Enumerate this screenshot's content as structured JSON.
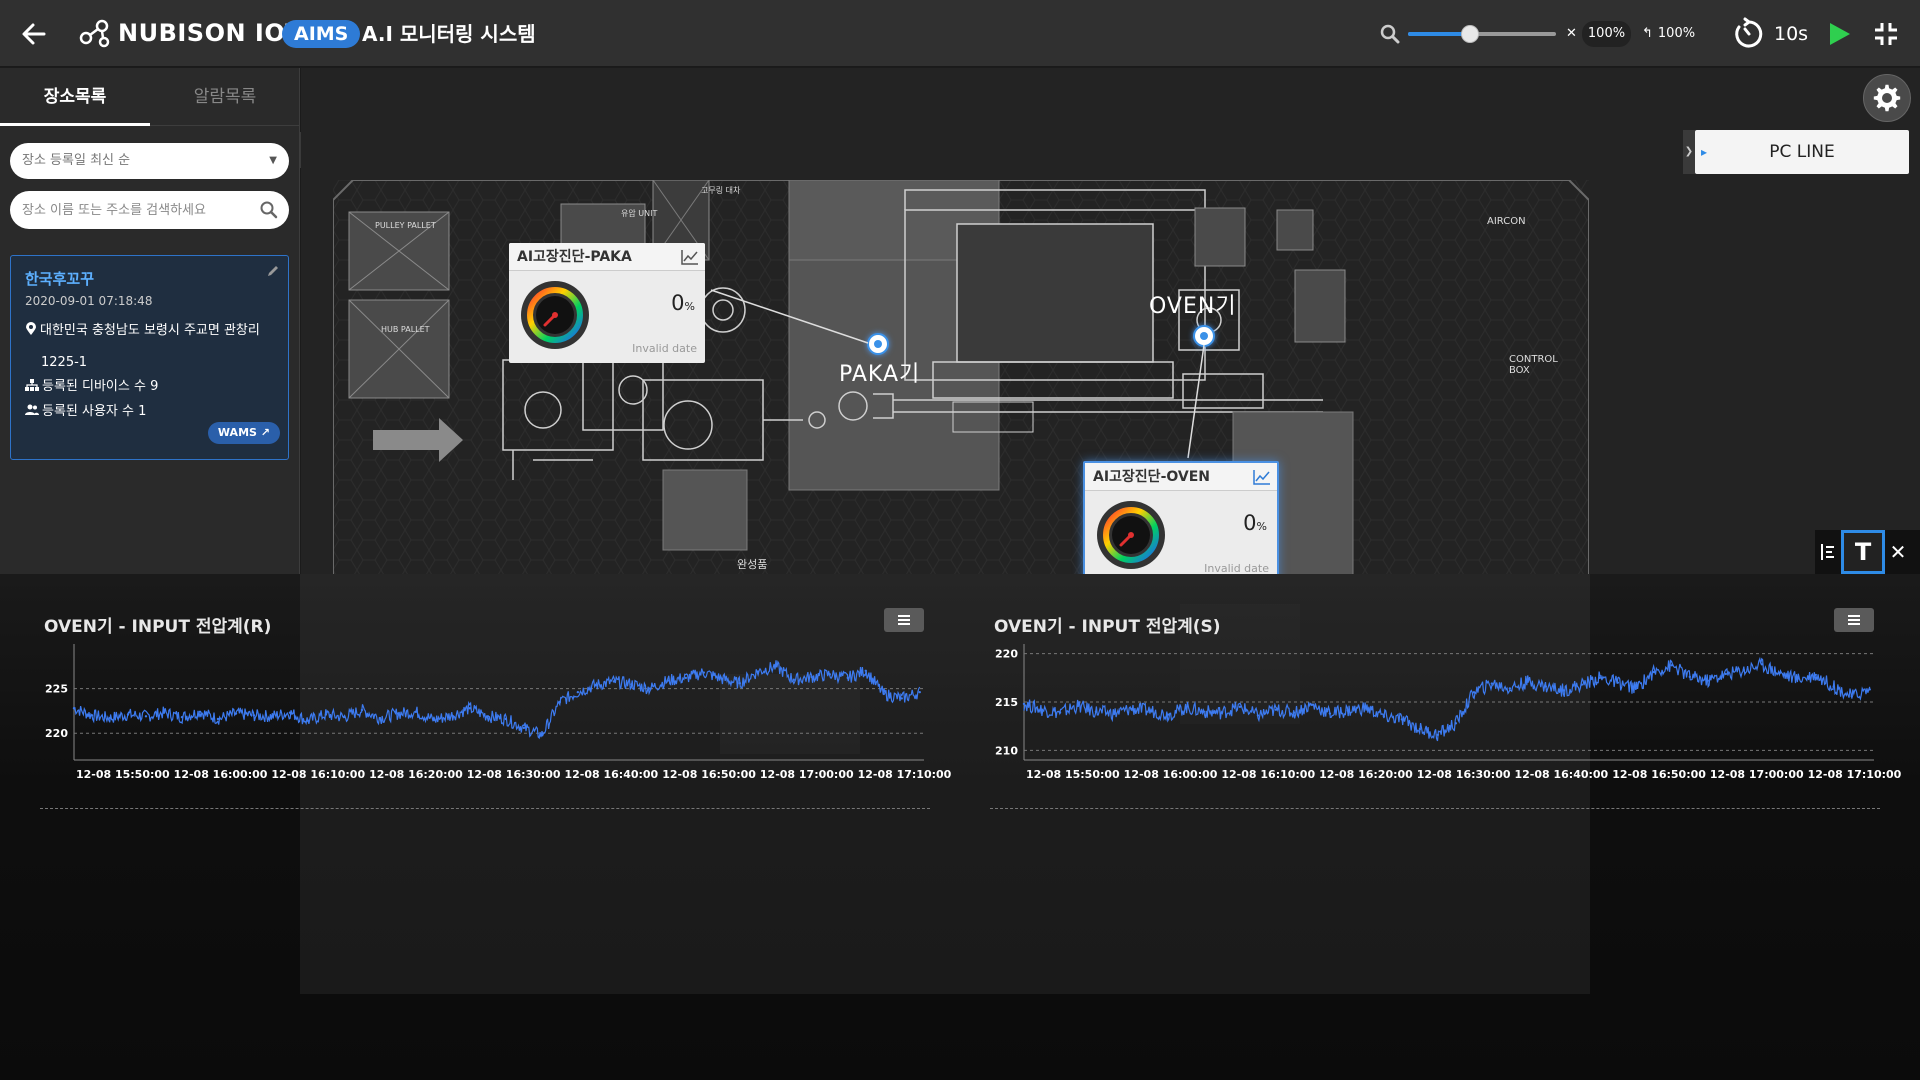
{
  "header": {
    "logo_text": "NUBISON IOT",
    "badge": "AIMS",
    "title": "A.I 모니터링 시스템",
    "zoom": {
      "level": 0.42,
      "scale_x": "100%",
      "scale_y": "100%"
    },
    "refresh_interval": "10s",
    "accent": "#2e7bd6"
  },
  "sidebar": {
    "tabs": [
      {
        "label": "장소목록"
      },
      {
        "label": "알람목록"
      }
    ],
    "sort": {
      "value": "장소 등록일 최신 순"
    },
    "search": {
      "placeholder": "장소 이름 또는 주소를 검색하세요"
    },
    "place": {
      "name": "한국후꼬꾸",
      "date": "2020-09-01 07:18:48",
      "address": "대한민국 충청남도 보령시 주교면 관창리",
      "address_2": "1225-1",
      "devices": "등록된 디바이스 수 9",
      "users": "등록된 사용자 수 1",
      "link": "WAMS ↗"
    }
  },
  "map": {
    "line_panel": "PC LINE",
    "machines": [
      {
        "label": "PAKA기"
      },
      {
        "label": "OVEN기"
      }
    ],
    "areas": {
      "pulley": "PULLEY PALLET",
      "hub": "HUB PALLET",
      "unit": "유압 UNIT",
      "cart": "고무링 대차",
      "aircon": "AIRCON",
      "control": "CONTROL BOX",
      "finished": "완성품"
    },
    "widgets": [
      {
        "title": "AI고장진단-PAKA",
        "value": "0",
        "unit": "%",
        "date": "Invalid date"
      },
      {
        "title": "AI고장진단-OVEN",
        "value": "0",
        "unit": "%",
        "date": "Invalid date"
      }
    ]
  },
  "charts": [
    {
      "title": "OVEN기 - INPUT 전압계(R)"
    },
    {
      "title": "OVEN기 - INPUT 전압계(S)"
    }
  ],
  "chart_data": [
    {
      "type": "line",
      "title": "OVEN기 - INPUT 전압계(R)",
      "x": [
        "12-08 15:50:00",
        "12-08 16:00:00",
        "12-08 16:10:00",
        "12-08 16:20:00",
        "12-08 16:30:00",
        "12-08 16:40:00",
        "12-08 16:50:00",
        "12-08 17:00:00",
        "12-08 17:10:00"
      ],
      "x_start": "12-08 15:45:00",
      "x_end": "12-08 17:12:00",
      "yticks": [
        220,
        225
      ],
      "ylim": [
        217,
        230
      ],
      "color": "#3d7bf0",
      "series": [
        {
          "values": [
            222.8,
            222.0,
            221.7,
            222.1,
            221.9,
            222.3,
            221.8,
            222.4,
            221.6,
            222.2,
            222.0,
            221.9,
            222.3,
            221.4,
            222.1,
            221.8,
            222.6,
            221.7,
            222.2,
            222.4,
            221.5,
            222.0,
            222.8,
            221.9,
            221.6,
            220.6,
            219.8,
            223.5,
            224.6,
            225.4,
            225.8,
            225.5,
            225.0,
            225.9,
            226.2,
            226.8,
            226.1,
            225.6,
            226.9,
            227.5,
            226.0,
            226.3,
            226.6,
            226.2,
            227.0,
            224.4,
            223.9,
            224.6
          ]
        }
      ]
    },
    {
      "type": "line",
      "title": "OVEN기 - INPUT 전압계(S)",
      "x": [
        "12-08 15:50:00",
        "12-08 16:00:00",
        "12-08 16:10:00",
        "12-08 16:20:00",
        "12-08 16:30:00",
        "12-08 16:40:00",
        "12-08 16:50:00",
        "12-08 17:00:00",
        "12-08 17:10:00"
      ],
      "x_start": "12-08 15:45:00",
      "x_end": "12-08 17:12:00",
      "yticks": [
        210,
        215,
        220
      ],
      "ylim": [
        209,
        221
      ],
      "color": "#3d7bf0",
      "series": [
        {
          "values": [
            214.8,
            214.2,
            213.9,
            214.6,
            214.0,
            213.8,
            214.3,
            214.1,
            213.7,
            214.4,
            214.0,
            213.9,
            214.5,
            213.6,
            214.2,
            213.9,
            214.7,
            213.8,
            214.1,
            214.4,
            213.5,
            213.2,
            212.2,
            211.6,
            212.8,
            216.0,
            216.9,
            216.4,
            217.1,
            216.6,
            216.2,
            216.8,
            217.5,
            217.0,
            216.4,
            218.1,
            218.8,
            217.6,
            217.2,
            217.9,
            218.3,
            218.9,
            218.0,
            217.4,
            217.8,
            216.6,
            215.6,
            216.3
          ]
        }
      ]
    }
  ]
}
